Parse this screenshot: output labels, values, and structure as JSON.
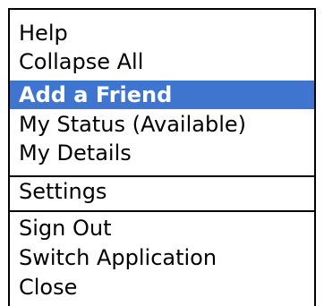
{
  "menu": {
    "items": [
      {
        "label": "Help"
      },
      {
        "label": "Collapse All"
      },
      {
        "label": "Add a Friend",
        "selected": true
      },
      {
        "label": "My Status (Available)"
      },
      {
        "label": "My Details"
      },
      {
        "label": "Settings"
      },
      {
        "label": "Sign Out"
      },
      {
        "label": "Switch Application"
      },
      {
        "label": "Close"
      }
    ],
    "selected_color": "#3f75cf"
  }
}
